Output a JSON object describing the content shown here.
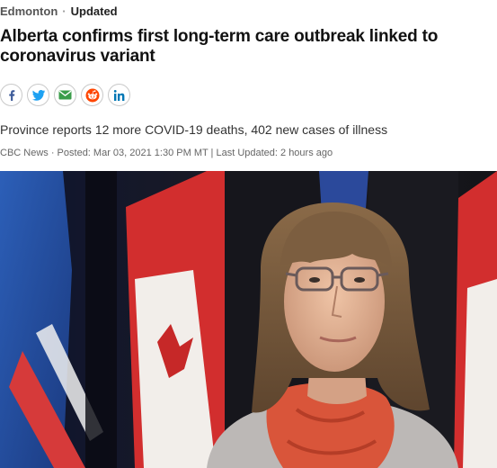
{
  "kicker": {
    "section": "Edmonton",
    "separator": "·",
    "status": "Updated"
  },
  "headline": "Alberta confirms first long-term care outbreak linked to coronavirus variant",
  "share": [
    {
      "name": "facebook-icon",
      "color": "#3b5998"
    },
    {
      "name": "twitter-icon",
      "color": "#1da1f2"
    },
    {
      "name": "email-icon",
      "color": "#3a9d4a"
    },
    {
      "name": "reddit-icon",
      "color": "#ff4500"
    },
    {
      "name": "linkedin-icon",
      "color": "#0077b5"
    }
  ],
  "dek": "Province reports 12 more COVID-19 deaths, 402 new cases of illness",
  "byline": "CBC News · Posted: Mar 03, 2021 1:30 PM MT | Last Updated: 2 hours ago",
  "hero": {
    "alt_icon": "photo-of-woman-in-front-of-flags"
  }
}
